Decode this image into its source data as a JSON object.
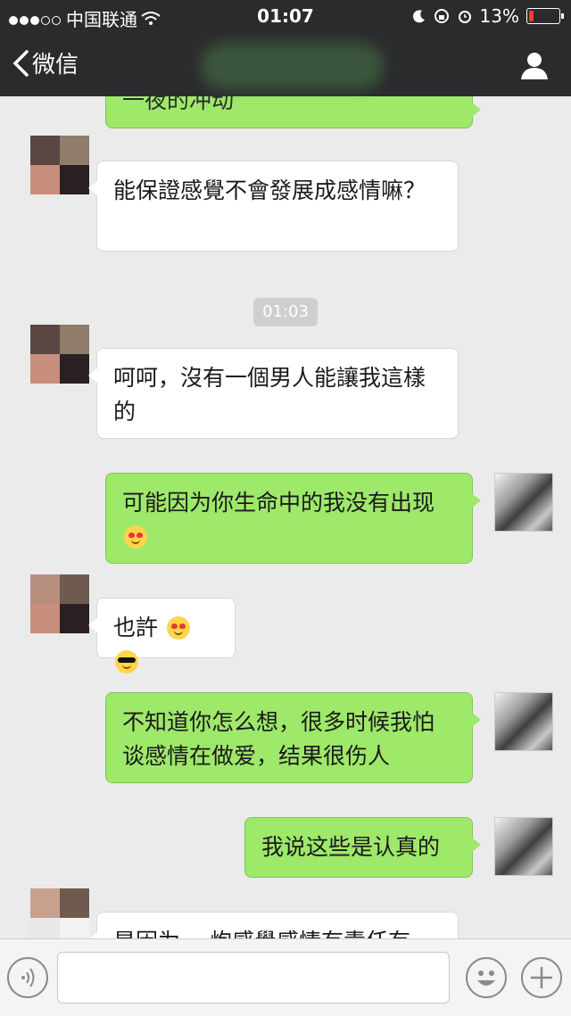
{
  "status_bar": {
    "carrier": "中国联通",
    "time": "01:07",
    "battery_percent": "13%"
  },
  "nav": {
    "back_label": "微信"
  },
  "chat": {
    "partial_top_message": "一夜的冲动",
    "messages": [
      {
        "side": "in",
        "text": "能保證感覺不會發展成感情嘛？"
      },
      {
        "side": "in",
        "text": "呵呵，沒有一個男人能讓我這樣的"
      },
      {
        "side": "out",
        "text": "可能因为你生命中的我没有出现"
      },
      {
        "side": "in",
        "text": "也許"
      },
      {
        "side": "out",
        "text": "不知道你怎么想，很多时候我怕谈感情在做爱，结果很伤人"
      },
      {
        "side": "out",
        "text": "我说这些是认真的"
      },
      {
        "side": "in",
        "text": "是因为一 炮感覺感情有責任有"
      }
    ],
    "timestamp": "01:03"
  },
  "input_bar": {
    "placeholder": ""
  },
  "colors": {
    "bar_background": "#2b2b2d",
    "chat_background": "#ebebeb",
    "outgoing_bubble": "#9ee86a",
    "incoming_bubble": "#ffffff"
  }
}
